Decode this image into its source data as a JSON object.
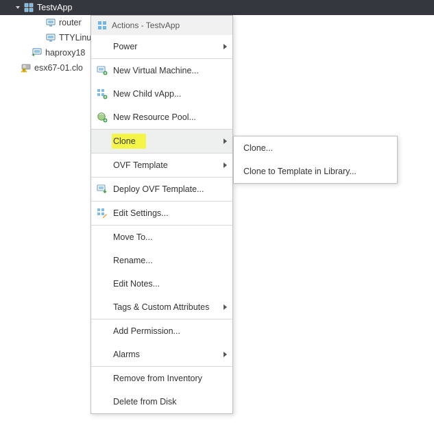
{
  "tree": {
    "vapp": "TestvApp",
    "vm1": "router",
    "vm2": "TTYLinu",
    "haproxy": "haproxy18",
    "host": "esx67-01.clo"
  },
  "menu": {
    "header": "Actions - TestvApp",
    "power": "Power",
    "newVm": "New Virtual Machine...",
    "newChild": "New Child vApp...",
    "newRp": "New Resource Pool...",
    "clone": "Clone",
    "ovf": "OVF Template",
    "deployOvf": "Deploy OVF Template...",
    "editSettings": "Edit Settings...",
    "moveTo": "Move To...",
    "rename": "Rename...",
    "editNotes": "Edit Notes...",
    "tags": "Tags & Custom Attributes",
    "addPerm": "Add Permission...",
    "alarms": "Alarms",
    "remove": "Remove from Inventory",
    "delete": "Delete from Disk"
  },
  "submenu": {
    "clone": "Clone...",
    "cloneTpl": "Clone to Template in Library..."
  }
}
